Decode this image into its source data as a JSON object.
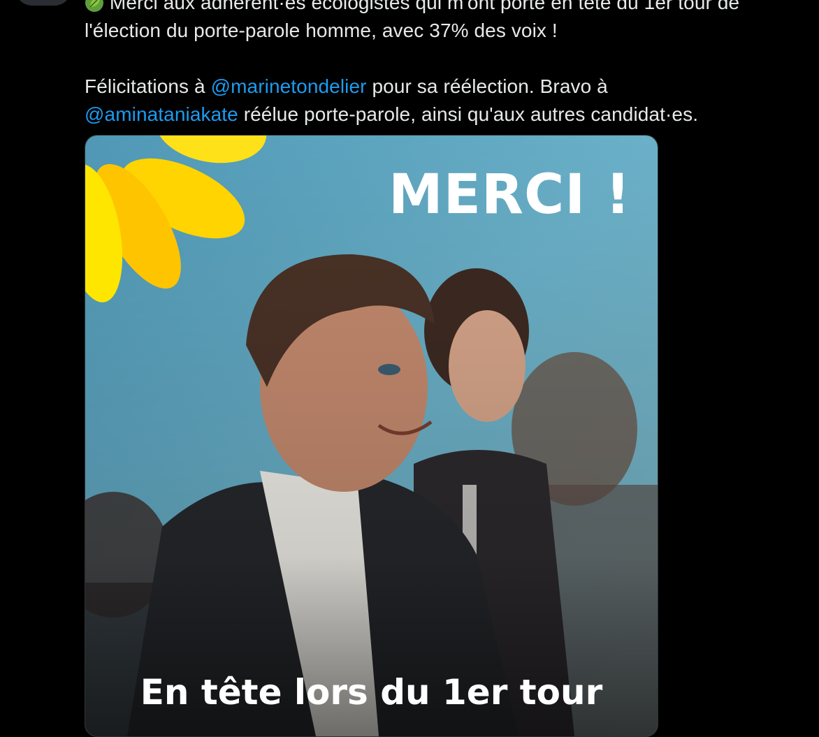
{
  "tweet": {
    "line1": "Merci aux adhérent·es écologistes qui m'ont porté en tête du 1er tour de",
    "line2": "l'élection du porte-parole homme, avec 37% des voix !",
    "p2_prefix": "Félicitations à ",
    "mention1": "@marinetondelier",
    "p2_middle": " pour sa réélection. Bravo à",
    "mention2": "@aminataniakate",
    "p2_suffix": " réélue porte-parole, ainsi qu'aux autres candidat·es."
  },
  "media": {
    "headline": "MERCI !",
    "caption": "En tête lors du 1er tour"
  },
  "colors": {
    "background": "#000000",
    "text": "#e7e9ea",
    "link": "#1d9bf0",
    "sunflower": "#ffd400",
    "photo_sky": "#5fa3bf"
  },
  "icons": {
    "leaf": "green-leaf-emoji"
  }
}
